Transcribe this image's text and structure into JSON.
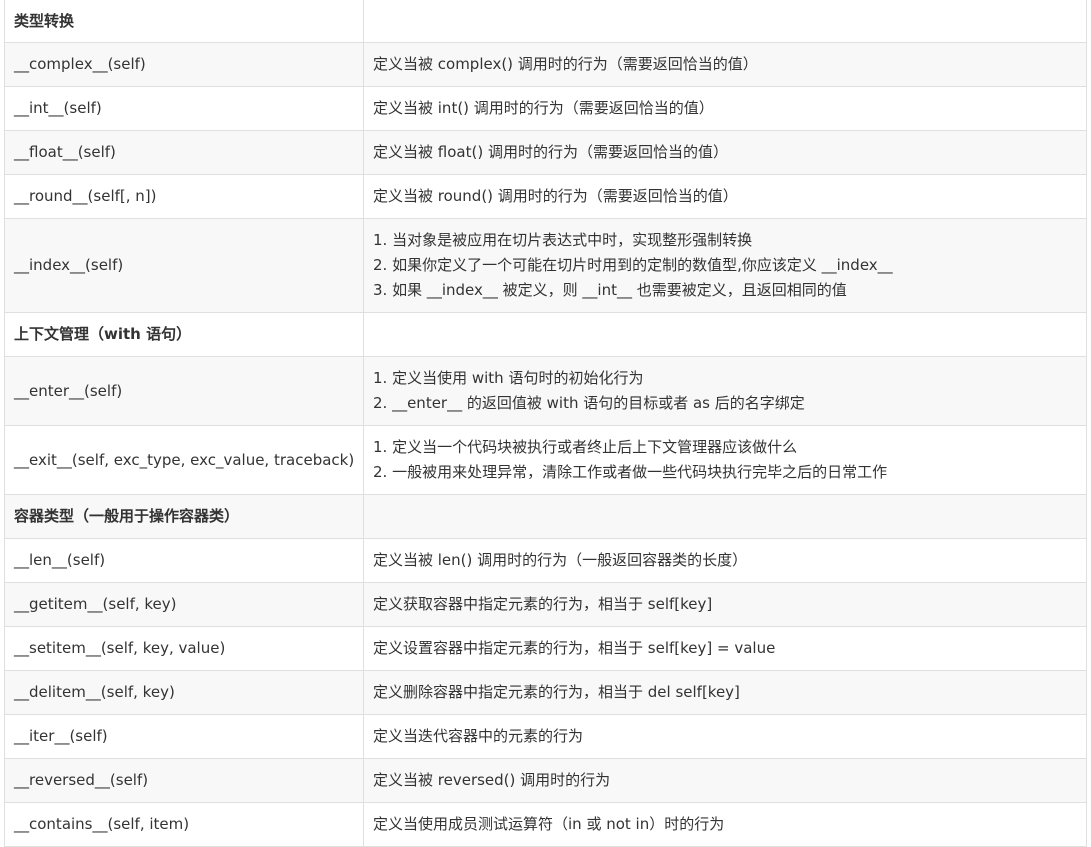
{
  "rows": [
    {
      "kind": "header",
      "name": "类型转换",
      "desc": []
    },
    {
      "kind": "row",
      "name": "__complex__(self)",
      "desc": [
        "定义当被 complex() 调用时的行为（需要返回恰当的值）"
      ]
    },
    {
      "kind": "row",
      "name": "__int__(self)",
      "desc": [
        "定义当被 int() 调用时的行为（需要返回恰当的值）"
      ]
    },
    {
      "kind": "row",
      "name": "__float__(self)",
      "desc": [
        "定义当被 float() 调用时的行为（需要返回恰当的值）"
      ]
    },
    {
      "kind": "row",
      "name": "__round__(self[, n])",
      "desc": [
        "定义当被 round() 调用时的行为（需要返回恰当的值）"
      ]
    },
    {
      "kind": "row",
      "name": "__index__(self)",
      "desc": [
        "1. 当对象是被应用在切片表达式中时，实现整形强制转换",
        "2. 如果你定义了一个可能在切片时用到的定制的数值型,你应该定义 __index__",
        "3. 如果 __index__ 被定义，则 __int__ 也需要被定义，且返回相同的值"
      ]
    },
    {
      "kind": "header",
      "name": "上下文管理（with 语句）",
      "desc": []
    },
    {
      "kind": "row",
      "name": "__enter__(self)",
      "desc": [
        "1. 定义当使用 with 语句时的初始化行为",
        "2. __enter__ 的返回值被 with 语句的目标或者 as 后的名字绑定"
      ]
    },
    {
      "kind": "row",
      "name": "__exit__(self, exc_type, exc_value, traceback)",
      "desc": [
        "1. 定义当一个代码块被执行或者终止后上下文管理器应该做什么",
        "2. 一般被用来处理异常，清除工作或者做一些代码块执行完毕之后的日常工作"
      ]
    },
    {
      "kind": "header",
      "name": "容器类型（一般用于操作容器类）",
      "desc": []
    },
    {
      "kind": "row",
      "name": "__len__(self)",
      "desc": [
        "定义当被 len() 调用时的行为（一般返回容器类的长度）"
      ]
    },
    {
      "kind": "row",
      "name": "__getitem__(self, key)",
      "desc": [
        "定义获取容器中指定元素的行为，相当于 self[key]"
      ]
    },
    {
      "kind": "row",
      "name": "__setitem__(self, key, value)",
      "desc": [
        "定义设置容器中指定元素的行为，相当于 self[key] = value"
      ]
    },
    {
      "kind": "row",
      "name": "__delitem__(self, key)",
      "desc": [
        "定义删除容器中指定元素的行为，相当于 del self[key]"
      ]
    },
    {
      "kind": "row",
      "name": "__iter__(self)",
      "desc": [
        "定义当迭代容器中的元素的行为"
      ]
    },
    {
      "kind": "row",
      "name": "__reversed__(self)",
      "desc": [
        "定义当被 reversed() 调用时的行为"
      ]
    },
    {
      "kind": "row",
      "name": "__contains__(self, item)",
      "desc": [
        "定义当使用成员测试运算符（in 或 not in）时的行为"
      ]
    }
  ]
}
